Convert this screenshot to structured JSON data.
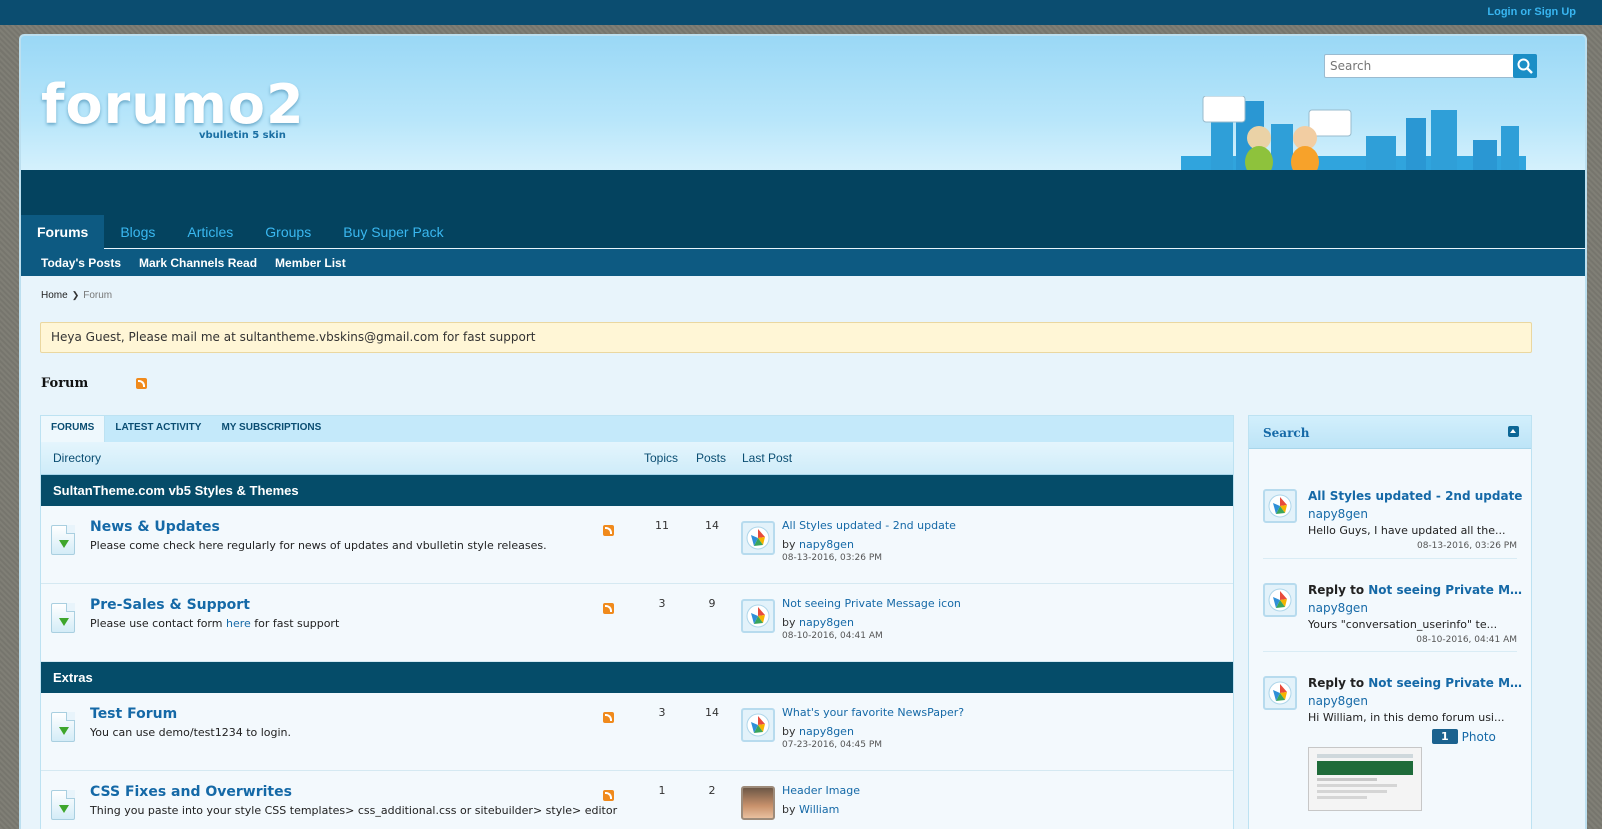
{
  "topbar": {
    "login_label": "Login or Sign Up"
  },
  "header": {
    "logo_text": "forumo2",
    "logo_sub": "vbulletin 5 skin",
    "search_placeholder": "Search"
  },
  "nav": {
    "tabs": [
      {
        "label": "Forums",
        "active": true
      },
      {
        "label": "Blogs"
      },
      {
        "label": "Articles"
      },
      {
        "label": "Groups"
      },
      {
        "label": "Buy Super Pack"
      }
    ],
    "subnav": [
      "Today's Posts",
      "Mark Channels Read",
      "Member List"
    ]
  },
  "breadcrumb": {
    "home": "Home",
    "current": "Forum"
  },
  "notice": "Heya Guest, Please mail me at sultantheme.vbskins@gmail.com for fast support",
  "page_title": "Forum",
  "forum_tabs": [
    "FORUMS",
    "LATEST ACTIVITY",
    "MY SUBSCRIPTIONS"
  ],
  "columns": {
    "directory": "Directory",
    "topics": "Topics",
    "posts": "Posts",
    "last_post": "Last Post"
  },
  "categories": [
    {
      "title": "SultanTheme.com vb5 Styles & Themes",
      "forums": [
        {
          "title": "News & Updates",
          "desc": "Please come check here regularly for news of updates and vbulletin style releases.",
          "topics": "11",
          "posts": "14",
          "last_title": "All Styles updated - 2nd update",
          "last_by": "by ",
          "last_user": "napy8gen",
          "last_date": "08-13-2016, 03:26 PM"
        },
        {
          "title": "Pre-Sales & Support",
          "desc_pre": "Please use contact form ",
          "desc_link": "here",
          "desc_post": " for fast support",
          "topics": "3",
          "posts": "9",
          "last_title": "Not seeing Private Message icon",
          "last_by": "by ",
          "last_user": "napy8gen",
          "last_date": "08-10-2016, 04:41 AM"
        }
      ]
    },
    {
      "title": "Extras",
      "forums": [
        {
          "title": "Test Forum",
          "desc": "You can use demo/test1234 to login.",
          "topics": "3",
          "posts": "14",
          "last_title": "What's your favorite NewsPaper?",
          "last_by": "by ",
          "last_user": "napy8gen",
          "last_date": "07-23-2016, 04:45 PM"
        },
        {
          "title": "CSS Fixes and Overwrites",
          "desc": "Thing you paste into your style CSS templates> css_additional.css or sitebuilder> style> editor",
          "topics": "1",
          "posts": "2",
          "last_title": "Header Image",
          "last_by": "by ",
          "last_user": "William"
        }
      ]
    }
  ],
  "sidebar": {
    "title": "Search",
    "activity": [
      {
        "prefix": "",
        "title": "All Styles updated - 2nd update",
        "user": "napy8gen",
        "body": "Hello Guys, I have updated all the...",
        "date": "08-13-2016, 03:26 PM"
      },
      {
        "prefix": "Reply to ",
        "title": "Not seeing Private Mes...",
        "user": "napy8gen",
        "body": "Yours \"conversation_userinfo\" te...",
        "date": "08-10-2016, 04:41 AM"
      },
      {
        "prefix": "Reply to ",
        "title": "Not seeing Private Mes...",
        "user": "napy8gen",
        "body": "Hi William, in this demo forum usi...",
        "photo_count": "1",
        "photo_label": "Photo"
      }
    ]
  },
  "colors": {
    "topbar": "#0b4d70",
    "nav_dark": "#04435f",
    "nav_accent": "#0d5a82",
    "link_blue": "#1569a7",
    "light_blue_tab": "#3ab8f1",
    "rss_orange": "#f08a1c"
  }
}
